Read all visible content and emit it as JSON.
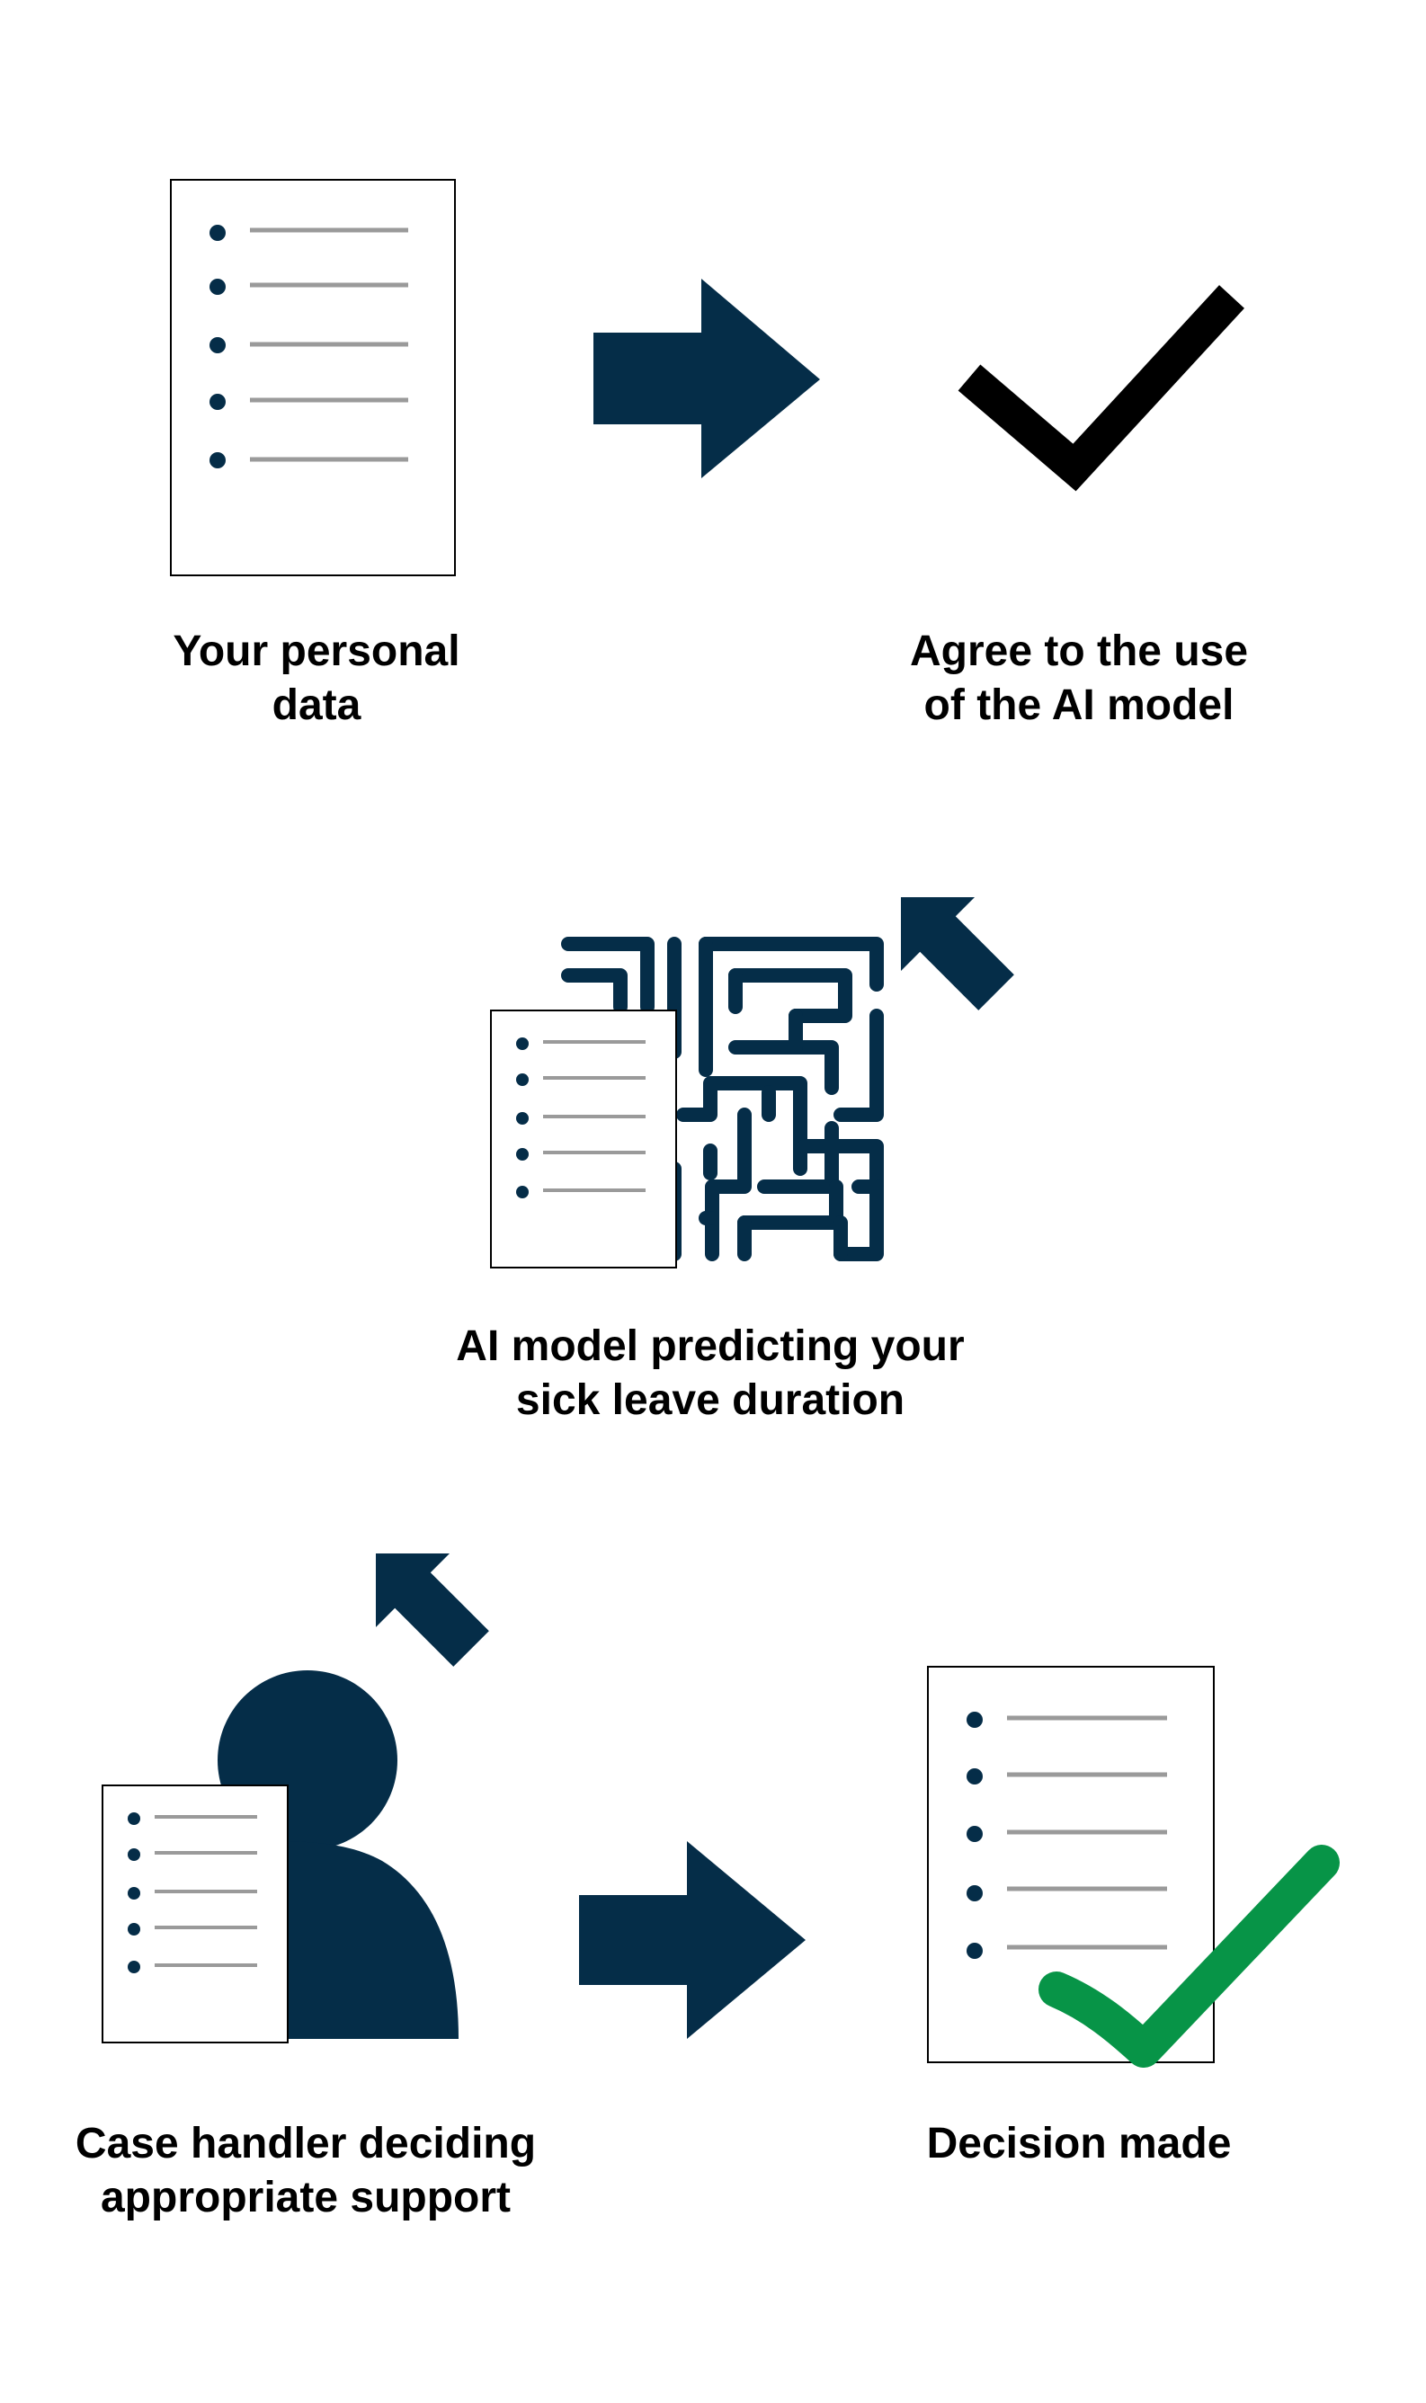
{
  "diagram": {
    "steps": [
      {
        "id": "personal-data",
        "label_lines": [
          "Your personal",
          "data"
        ]
      },
      {
        "id": "agree",
        "label_lines": [
          "Agree to the use",
          "of the AI model"
        ]
      },
      {
        "id": "ai-model",
        "label_lines": [
          "AI model predicting your",
          "sick leave duration"
        ]
      },
      {
        "id": "case-handler",
        "label_lines": [
          "Case handler deciding",
          "appropriate support"
        ]
      },
      {
        "id": "decision",
        "label_lines": [
          "Decision made"
        ]
      }
    ]
  },
  "colors": {
    "navy": "#052d48",
    "line_gray": "#9a9a9a",
    "check_black": "#000000",
    "check_green": "#079447",
    "doc_border": "#000000"
  },
  "icons": [
    "document-icon",
    "arrow-right-icon",
    "checkmark-icon",
    "arrow-down-left-icon",
    "maze-icon",
    "person-icon",
    "green-checkmark-icon"
  ]
}
